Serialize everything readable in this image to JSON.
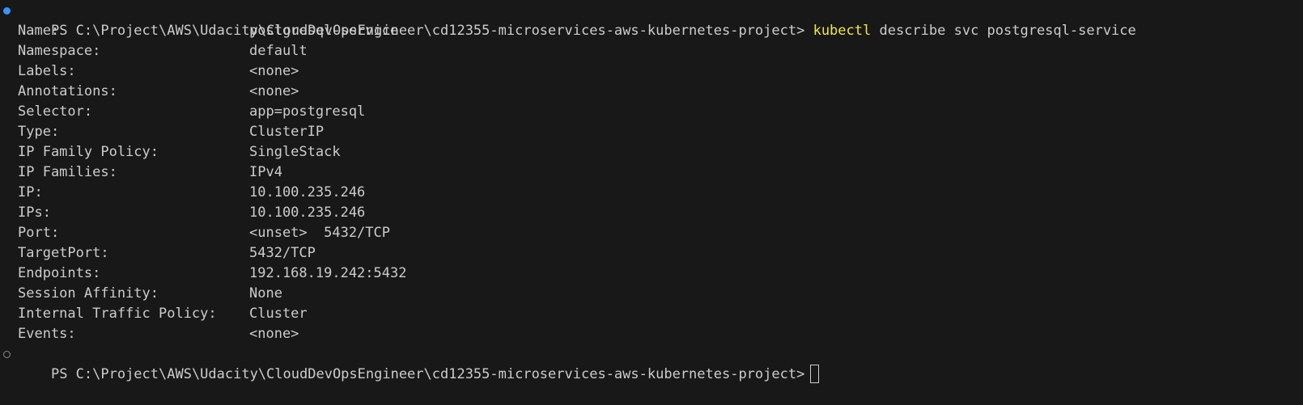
{
  "terminal": {
    "prompt": "PS C:\\Project\\AWS\\Udacity\\CloudDevOpsEngineer\\cd12355-microservices-aws-kubernetes-project>",
    "command": {
      "program": "kubectl",
      "args": "describe svc postgresql-service"
    },
    "output": [
      {
        "key": "Name:",
        "value": "postgresql-service"
      },
      {
        "key": "Namespace:",
        "value": "default"
      },
      {
        "key": "Labels:",
        "value": "<none>"
      },
      {
        "key": "Annotations:",
        "value": "<none>"
      },
      {
        "key": "Selector:",
        "value": "app=postgresql"
      },
      {
        "key": "Type:",
        "value": "ClusterIP"
      },
      {
        "key": "IP Family Policy:",
        "value": "SingleStack"
      },
      {
        "key": "IP Families:",
        "value": "IPv4"
      },
      {
        "key": "IP:",
        "value": "10.100.235.246"
      },
      {
        "key": "IPs:",
        "value": "10.100.235.246"
      },
      {
        "key": "Port:",
        "value": "<unset>  5432/TCP"
      },
      {
        "key": "TargetPort:",
        "value": "5432/TCP"
      },
      {
        "key": "Endpoints:",
        "value": "192.168.19.242:5432"
      },
      {
        "key": "Session Affinity:",
        "value": "None"
      },
      {
        "key": "Internal Traffic Policy:",
        "value": "Cluster"
      },
      {
        "key": "Events:",
        "value": "<none>"
      }
    ],
    "colors": {
      "background": "#181818",
      "text": "#cccccc",
      "command_highlight": "#f0e64a",
      "decoration_success": "#3794ff"
    }
  }
}
